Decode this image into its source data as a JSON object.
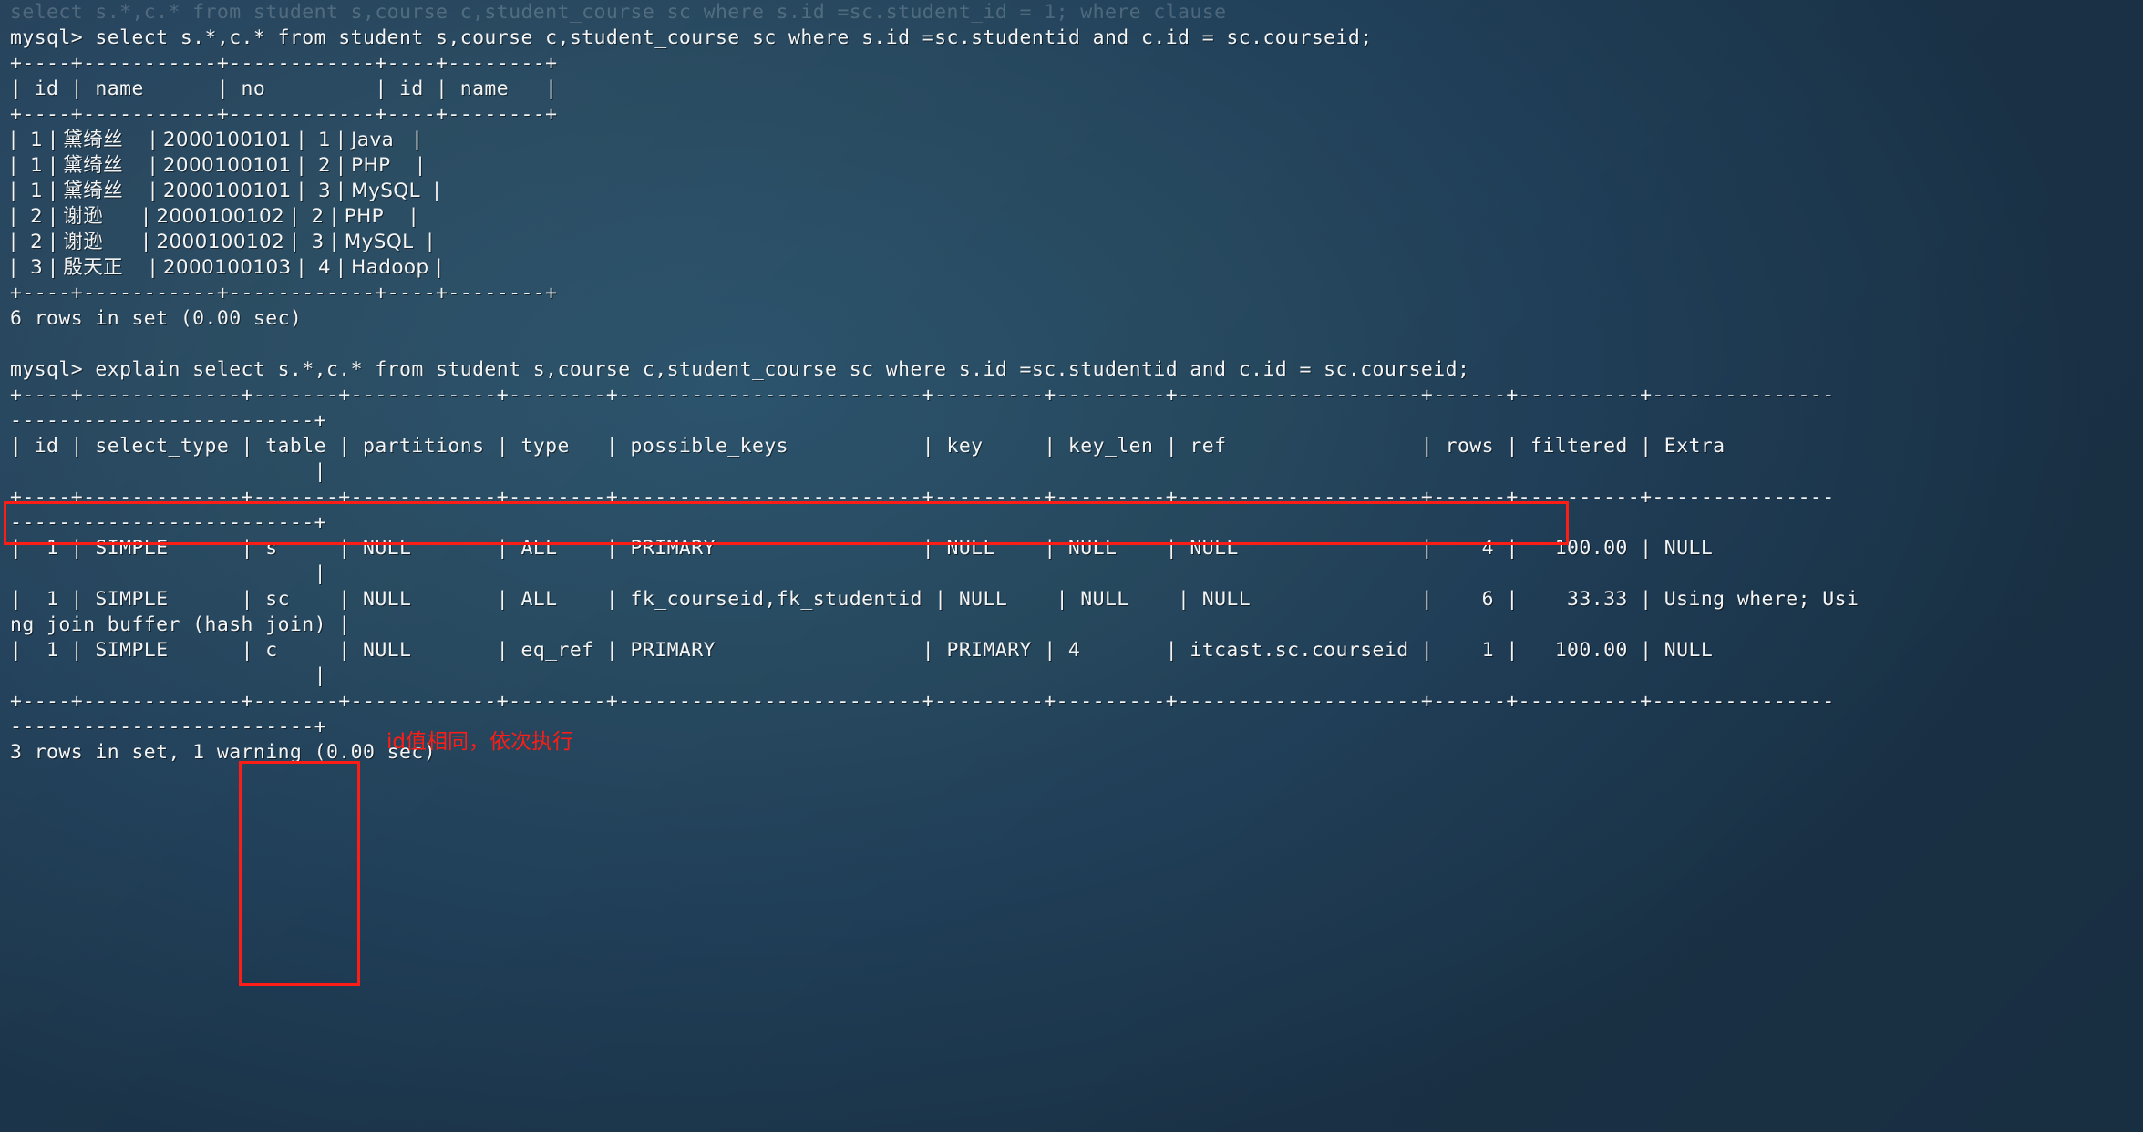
{
  "terminal": {
    "background_color": "#27495f",
    "text_color": "#f2f4f5",
    "annotation_color": "#fb1d16",
    "prompt": "mysql>"
  },
  "annotations": {
    "explain_box_label": "explain-statement-highlight",
    "table_column_box_label": "table-column-highlight",
    "note_id_same": "id值相同，依次执行"
  },
  "lines": [
    {
      "id": "l00",
      "text": "select s.*,c.* from student s,course c,student_course sc where s.id =sc.student_id = 1; where clause",
      "faint": true
    },
    {
      "id": "l01",
      "text": "mysql> select s.*,c.* from student s,course c,student_course sc where s.id =sc.studentid and c.id = sc.courseid;"
    },
    {
      "id": "l02",
      "text": "+----+-----------+------------+----+--------+"
    },
    {
      "id": "l03",
      "text": "| id | name      | no         | id | name   |"
    },
    {
      "id": "l04",
      "text": "+----+-----------+------------+----+--------+"
    },
    {
      "id": "l05",
      "text": "|  1 | 黛绮丝    | 2000100101 |  1 | Java   |",
      "cjk": true
    },
    {
      "id": "l06",
      "text": "|  1 | 黛绮丝    | 2000100101 |  2 | PHP    |",
      "cjk": true
    },
    {
      "id": "l07",
      "text": "|  1 | 黛绮丝    | 2000100101 |  3 | MySQL  |",
      "cjk": true
    },
    {
      "id": "l08",
      "text": "|  2 | 谢逊      | 2000100102 |  2 | PHP    |",
      "cjk": true
    },
    {
      "id": "l09",
      "text": "|  2 | 谢逊      | 2000100102 |  3 | MySQL  |",
      "cjk": true
    },
    {
      "id": "l10",
      "text": "|  3 | 殷天正    | 2000100103 |  4 | Hadoop |",
      "cjk": true
    },
    {
      "id": "l11",
      "text": "+----+-----------+------------+----+--------+"
    },
    {
      "id": "l12",
      "text": "6 rows in set (0.00 sec)"
    },
    {
      "id": "l13",
      "text": ""
    },
    {
      "id": "l14",
      "text": "mysql> explain select s.*,c.* from student s,course c,student_course sc where s.id =sc.studentid and c.id = sc.courseid;"
    },
    {
      "id": "l15",
      "text": "+----+-------------+-------+------------+--------+-------------------------+---------+---------+--------------------+------+----------+---------------"
    },
    {
      "id": "l16",
      "text": "-------------------------+"
    },
    {
      "id": "l17",
      "text": "| id | select_type | table | partitions | type   | possible_keys           | key     | key_len | ref                | rows | filtered | Extra"
    },
    {
      "id": "l18",
      "text": "                         |"
    },
    {
      "id": "l19",
      "text": "+----+-------------+-------+------------+--------+-------------------------+---------+---------+--------------------+------+----------+---------------"
    },
    {
      "id": "l20",
      "text": "-------------------------+"
    },
    {
      "id": "l21",
      "text": "|  1 | SIMPLE      | s     | NULL       | ALL    | PRIMARY                 | NULL    | NULL    | NULL               |    4 |   100.00 | NULL"
    },
    {
      "id": "l22",
      "text": "                         |"
    },
    {
      "id": "l23",
      "text": "|  1 | SIMPLE      | sc    | NULL       | ALL    | fk_courseid,fk_studentid | NULL    | NULL    | NULL              |    6 |    33.33 | Using where; Usi"
    },
    {
      "id": "l24",
      "text": "ng join buffer (hash join) |"
    },
    {
      "id": "l25",
      "text": "|  1 | SIMPLE      | c     | NULL       | eq_ref | PRIMARY                 | PRIMARY | 4       | itcast.sc.courseid |    1 |   100.00 | NULL"
    },
    {
      "id": "l26",
      "text": "                         |"
    },
    {
      "id": "l27",
      "text": "+----+-------------+-------+------------+--------+-------------------------+---------+---------+--------------------+------+----------+---------------"
    },
    {
      "id": "l28",
      "text": "-------------------------+"
    },
    {
      "id": "l29",
      "text": "3 rows in set, 1 warning (0.00 sec)"
    }
  ],
  "query_result": {
    "type": "table",
    "columns": [
      "id",
      "name",
      "no",
      "id",
      "name"
    ],
    "rows": [
      [
        "1",
        "黛绮丝",
        "2000100101",
        "1",
        "Java"
      ],
      [
        "1",
        "黛绮丝",
        "2000100101",
        "2",
        "PHP"
      ],
      [
        "1",
        "黛绮丝",
        "2000100101",
        "3",
        "MySQL"
      ],
      [
        "2",
        "谢逊",
        "2000100102",
        "2",
        "PHP"
      ],
      [
        "2",
        "谢逊",
        "2000100102",
        "3",
        "MySQL"
      ],
      [
        "3",
        "殷天正",
        "2000100103",
        "4",
        "Hadoop"
      ]
    ],
    "status": "6 rows in set (0.00 sec)"
  },
  "explain_result": {
    "type": "table",
    "columns": [
      "id",
      "select_type",
      "table",
      "partitions",
      "type",
      "possible_keys",
      "key",
      "key_len",
      "ref",
      "rows",
      "filtered",
      "Extra"
    ],
    "rows": [
      [
        "1",
        "SIMPLE",
        "s",
        "NULL",
        "ALL",
        "PRIMARY",
        "NULL",
        "NULL",
        "NULL",
        "4",
        "100.00",
        "NULL"
      ],
      [
        "1",
        "SIMPLE",
        "sc",
        "NULL",
        "ALL",
        "fk_courseid,fk_studentid",
        "NULL",
        "NULL",
        "NULL",
        "6",
        "33.33",
        "Using where; Using join buffer (hash join)"
      ],
      [
        "1",
        "SIMPLE",
        "c",
        "NULL",
        "eq_ref",
        "PRIMARY",
        "PRIMARY",
        "4",
        "itcast.sc.courseid",
        "1",
        "100.00",
        "NULL"
      ]
    ],
    "status": "3 rows in set, 1 warning (0.00 sec)"
  },
  "commands": {
    "select_statement": "select s.*,c.* from student s,course c,student_course sc where s.id =sc.studentid and c.id = sc.courseid;",
    "explain_statement": "explain select s.*,c.* from student s,course c,student_course sc where s.id =sc.studentid and c.id = sc.courseid;"
  }
}
